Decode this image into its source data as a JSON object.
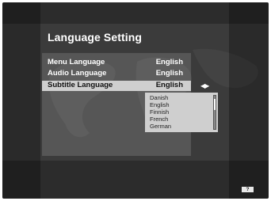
{
  "menu": {
    "title": "Language Setting",
    "items": [
      {
        "label": "Menu Language",
        "value": "English"
      },
      {
        "label": "Audio Language",
        "value": "English"
      },
      {
        "label": "Subtitle Language",
        "value": "English"
      }
    ],
    "selected_index": 2
  },
  "dropdown": {
    "options": [
      "Danish",
      "English",
      "Finnish",
      "French",
      "German"
    ]
  },
  "icons": {
    "left_right_arrows": "left-right-arrows-icon",
    "help": "help-icon"
  },
  "help_badge": "?",
  "colors": {
    "background": "#3b3b3b",
    "highlight": "#cfcfcf",
    "text": "#ffffff"
  }
}
